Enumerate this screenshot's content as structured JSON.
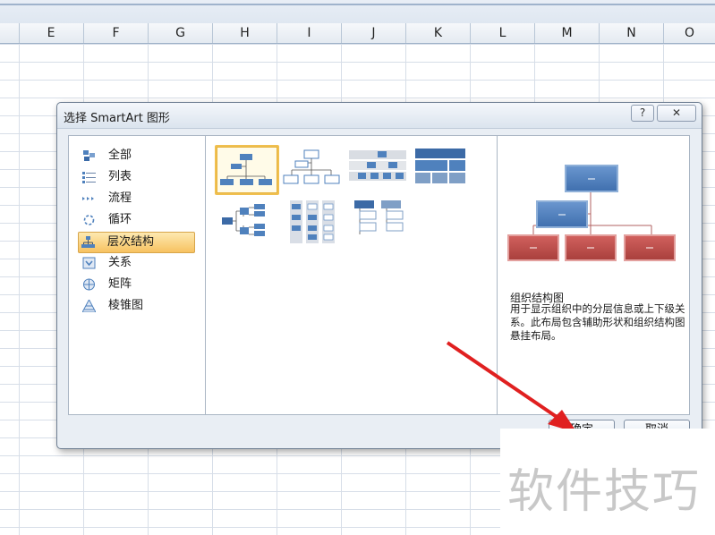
{
  "spreadsheet": {
    "columns": [
      "E",
      "F",
      "G",
      "H",
      "I",
      "J",
      "K",
      "L",
      "M",
      "N",
      "O"
    ]
  },
  "dialog": {
    "title": "选择 SmartArt 图形",
    "help_label": "?",
    "close_label": "✕",
    "categories": [
      {
        "label": "全部",
        "icon": "all-icon"
      },
      {
        "label": "列表",
        "icon": "list-icon"
      },
      {
        "label": "流程",
        "icon": "process-icon"
      },
      {
        "label": "循环",
        "icon": "cycle-icon"
      },
      {
        "label": "层次结构",
        "icon": "hierarchy-icon",
        "selected": true
      },
      {
        "label": "关系",
        "icon": "relationship-icon"
      },
      {
        "label": "矩阵",
        "icon": "matrix-icon"
      },
      {
        "label": "棱锥图",
        "icon": "pyramid-icon"
      }
    ],
    "preview": {
      "title": "组织结构图",
      "description": "用于显示组织中的分层信息或上下级关系。此布局包含辅助形状和组织结构图悬挂布局。"
    },
    "ok_label": "确定",
    "cancel_label": "取消"
  },
  "watermark": "软件技巧",
  "colors": {
    "shape_blue": "#4f81bd",
    "shape_red": "#c0504d",
    "selection": "#f7c261",
    "arrow_red": "#e02020"
  }
}
